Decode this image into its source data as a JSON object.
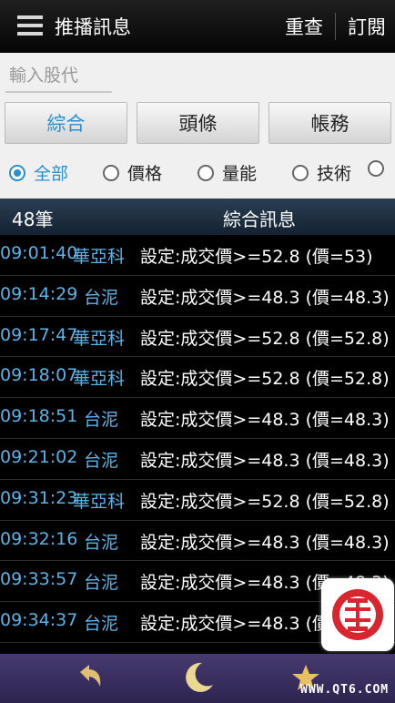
{
  "header": {
    "title": "推播訊息",
    "requery_label": "重查",
    "subscribe_label": "訂閱"
  },
  "search": {
    "placeholder": "輸入股代"
  },
  "categories": [
    {
      "label": "綜合",
      "active": true
    },
    {
      "label": "頭條"
    },
    {
      "label": "帳務"
    }
  ],
  "filters": [
    {
      "label": "全部",
      "selected": true
    },
    {
      "label": "價格"
    },
    {
      "label": "量能"
    },
    {
      "label": "技術"
    }
  ],
  "list_header": {
    "count": "48筆",
    "title": "綜合訊息"
  },
  "messages": [
    {
      "time": "09:01:40",
      "name": "華亞科",
      "text": "設定:成交價>=52.8 (價=53)"
    },
    {
      "time": "09:14:29",
      "name": "台泥",
      "text": "設定:成交價>=48.3 (價=48.3)"
    },
    {
      "time": "09:17:47",
      "name": "華亞科",
      "text": "設定:成交價>=52.8 (價=52.8)"
    },
    {
      "time": "09:18:07",
      "name": "華亞科",
      "text": "設定:成交價>=52.8 (價=52.8)"
    },
    {
      "time": "09:18:51",
      "name": "台泥",
      "text": "設定:成交價>=48.3 (價=48.3)"
    },
    {
      "time": "09:21:02",
      "name": "台泥",
      "text": "設定:成交價>=48.3 (價=48.3)"
    },
    {
      "time": "09:31:23",
      "name": "華亞科",
      "text": "設定:成交價>=52.8 (價=52.8)"
    },
    {
      "time": "09:32:16",
      "name": "台泥",
      "text": "設定:成交價>=48.3 (價=48.3)"
    },
    {
      "time": "09:33:57",
      "name": "台泥",
      "text": "設定:成交價>=48.3 (價=48.3)"
    },
    {
      "time": "09:34:37",
      "name": "台泥",
      "text": "設定:成交價>=48.3 (價=48.3)"
    }
  ],
  "watermark": "WWW.QT6.COM",
  "colors": {
    "accent": "#2a8fd0",
    "list_text": "#5ab4e8",
    "bottom_bar": "#3a2f60",
    "star": "#e8c060"
  }
}
